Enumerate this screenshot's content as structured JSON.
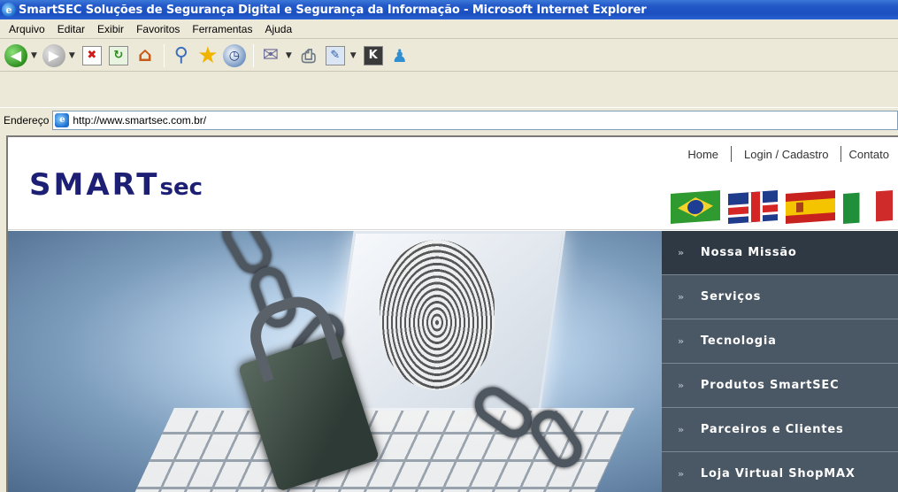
{
  "window": {
    "title": "SmartSEC Soluções de Segurança Digital e Segurança da Informação - Microsoft Internet Explorer"
  },
  "menubar": {
    "items": [
      "Arquivo",
      "Editar",
      "Exibir",
      "Favoritos",
      "Ferramentas",
      "Ajuda"
    ]
  },
  "toolbar": {
    "buttons": [
      {
        "icon": "back-arrow-icon"
      },
      {
        "icon": "forward-arrow-icon"
      },
      {
        "icon": "stop-icon"
      },
      {
        "icon": "refresh-icon"
      },
      {
        "icon": "home-icon"
      },
      {
        "icon": "search-icon"
      },
      {
        "icon": "favorites-star-icon"
      },
      {
        "icon": "history-icon"
      },
      {
        "icon": "mail-icon"
      },
      {
        "icon": "print-icon"
      },
      {
        "icon": "edit-icon"
      },
      {
        "icon": "discuss-icon"
      },
      {
        "icon": "messenger-icon"
      }
    ]
  },
  "address": {
    "label": "Endereço",
    "url": "http://www.smartsec.com.br/"
  },
  "page": {
    "logo": {
      "main": "SMART",
      "suffix": "sec"
    },
    "toplinks": [
      "Home",
      "Login / Cadastro",
      "Contato"
    ],
    "flags": [
      "brazil-flag-icon",
      "uk-flag-icon",
      "spain-flag-icon",
      "italy-flag-icon"
    ],
    "nav": {
      "arrow": "»",
      "items": [
        "Nossa Missão",
        "Serviços",
        "Tecnologia",
        "Produtos SmartSEC",
        "Parceiros e Clientes",
        "Loja Virtual ShopMAX"
      ]
    }
  }
}
